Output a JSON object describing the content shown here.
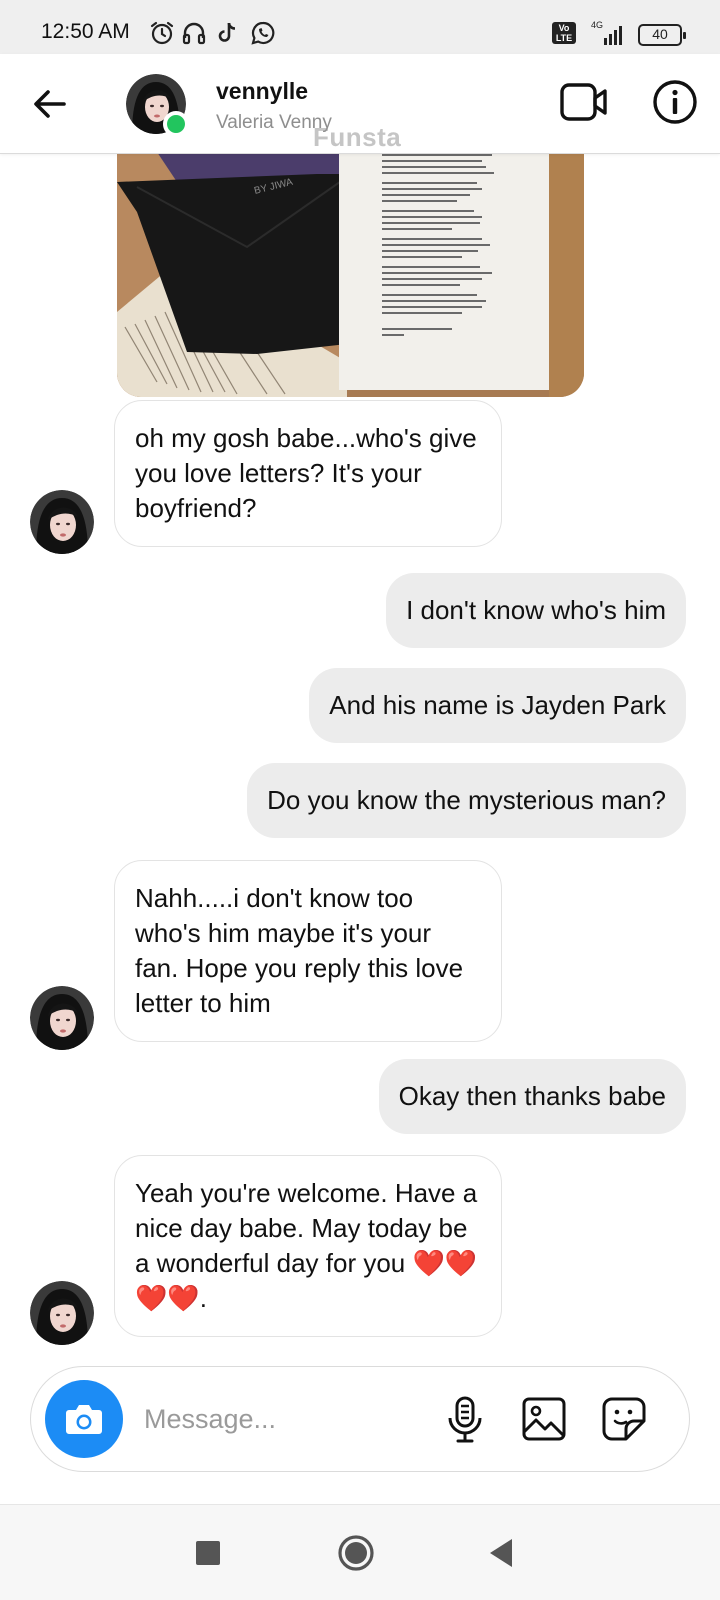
{
  "status_bar": {
    "time": "12:50 AM",
    "icons": [
      "alarm-icon",
      "headphones-icon",
      "tiktok-icon",
      "whatsapp-icon"
    ],
    "volte_badge": "Vo LTE",
    "network": "4G",
    "battery": "40"
  },
  "header": {
    "username": "vennylle",
    "full_name": "Valeria Venny",
    "online_color": "#22c55e",
    "watermark": "Funsta"
  },
  "shared_image": {
    "envelope_text": "BY JIWA"
  },
  "messages": [
    {
      "direction": "received",
      "text": "oh my gosh babe...who's give you love letters? It's your boyfriend?"
    },
    {
      "direction": "sent",
      "text": "I don't know who's him"
    },
    {
      "direction": "sent",
      "text": "And his name is Jayden Park"
    },
    {
      "direction": "sent",
      "text": "Do you know the mysterious man?"
    },
    {
      "direction": "received",
      "text": "Nahh.....i don't know too who's him maybe it's your fan. Hope you reply this love letter to him"
    },
    {
      "direction": "sent",
      "text": "Okay then thanks babe"
    },
    {
      "direction": "received",
      "text": "Yeah you're welcome. Have a nice day babe. May today be a wonderful day for you ❤️❤️❤️❤️."
    }
  ],
  "composer": {
    "placeholder": "Message...",
    "camera_color": "#1c8cf5"
  },
  "colors": {
    "received_bubble": "#ffffff",
    "sent_bubble": "#ececec",
    "accent": "#1c8cf5"
  }
}
